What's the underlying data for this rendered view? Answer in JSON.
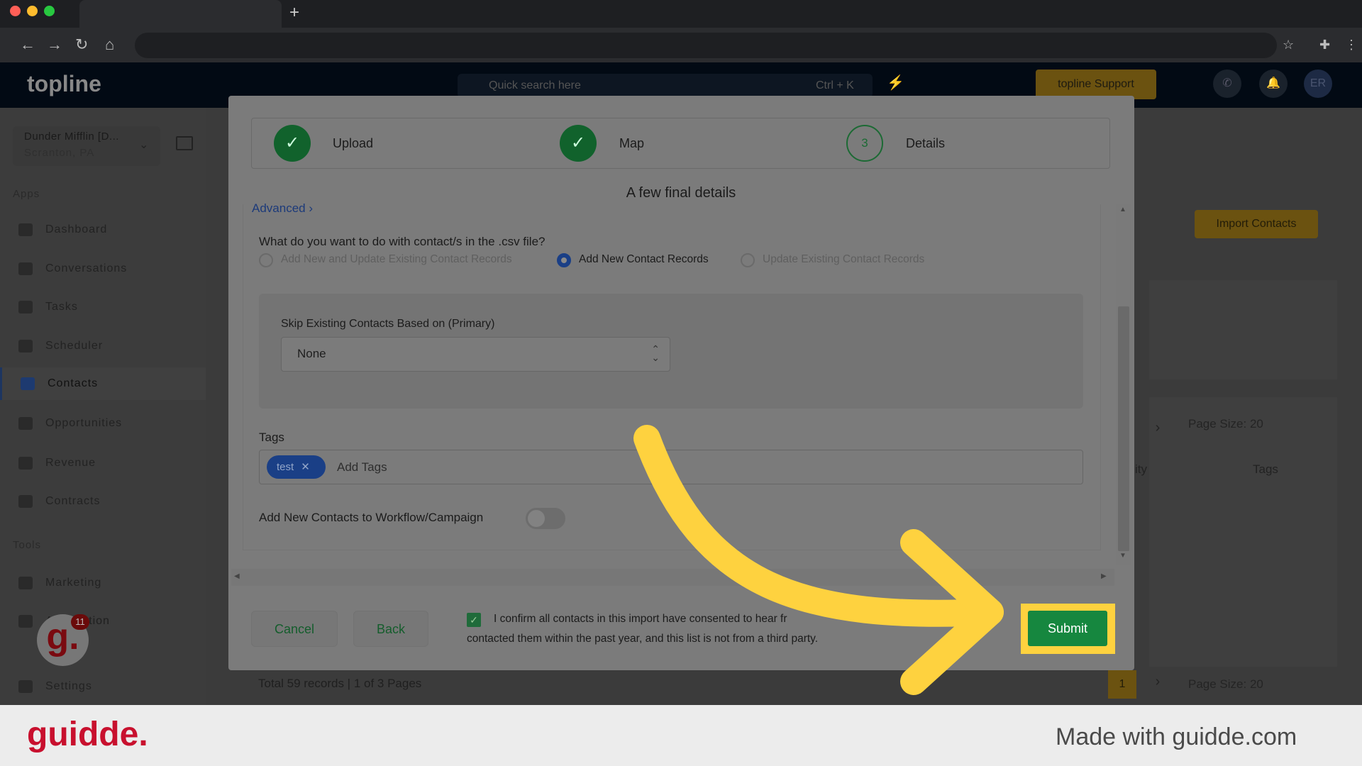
{
  "browser": {
    "new_tab": "+"
  },
  "app": {
    "logo": "topline",
    "search_placeholder": "Quick search here",
    "search_shortcut": "Ctrl + K",
    "support_button": "topline Support",
    "avatar": "ER"
  },
  "sidebar": {
    "account_name": "Dunder Mifflin [D...",
    "account_location": "Scranton, PA",
    "apps_label": "Apps",
    "tools_label": "Tools",
    "items": [
      {
        "label": "Dashboard"
      },
      {
        "label": "Conversations"
      },
      {
        "label": "Tasks"
      },
      {
        "label": "Scheduler"
      },
      {
        "label": "Contacts"
      },
      {
        "label": "Opportunities"
      },
      {
        "label": "Revenue"
      },
      {
        "label": "Contracts"
      }
    ],
    "tools": [
      {
        "label": "Marketing"
      },
      {
        "label": "Automation"
      },
      {
        "label": "Settings"
      }
    ],
    "automation_partial": "tion",
    "guidde_badge": "11"
  },
  "background": {
    "import_button": "Import Contacts",
    "page_size": "Page Size: 20",
    "column_tags": "Tags",
    "column_partial": "ity",
    "total_records": "Total 59 records",
    "pages": "1 of 3 Pages",
    "current_page": "1"
  },
  "modal": {
    "steps": [
      {
        "label": "Upload",
        "status": "done"
      },
      {
        "label": "Map",
        "status": "done"
      },
      {
        "number": "3",
        "label": "Details",
        "status": "current"
      }
    ],
    "title": "A few final details",
    "advanced_link": "Advanced",
    "question": "What do you want to do with contact/s in the .csv file?",
    "options": [
      {
        "label": "Add New and Update Existing Contact Records",
        "selected": false
      },
      {
        "label": "Add New Contact Records",
        "selected": true
      },
      {
        "label": "Update Existing Contact Records",
        "selected": false
      }
    ],
    "skip_label": "Skip Existing Contacts Based on (Primary)",
    "skip_value": "None",
    "tags_label": "Tags",
    "tags": [
      {
        "label": "test"
      }
    ],
    "tags_placeholder": "Add Tags",
    "workflow_label": "Add New Contacts to Workflow/Campaign",
    "workflow_enabled": false,
    "cancel": "Cancel",
    "back": "Back",
    "confirm_line1": "I confirm all contacts in this import have consented to hear fr",
    "confirm_line2": "contacted them within the past year, and this list is not from a third party.",
    "confirm_checked": true,
    "submit": "Submit"
  },
  "colors": {
    "accent_green": "#16873f",
    "highlight": "#fed23f",
    "brand_red": "#c8102e"
  },
  "watermark": {
    "logo": "guidde.",
    "text": "Made with guidde.com"
  }
}
